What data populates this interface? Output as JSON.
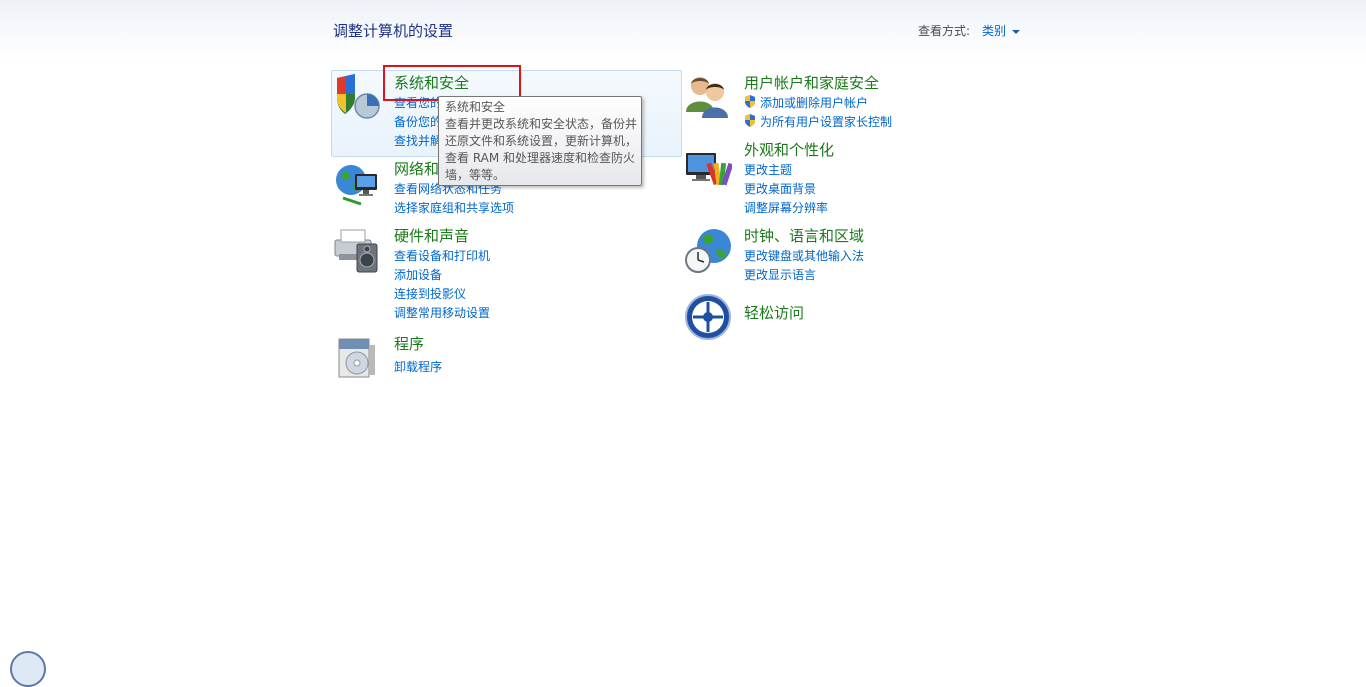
{
  "header": {
    "title": "调整计算机的设置",
    "view_by_label": "查看方式:",
    "view_by_value": "类别"
  },
  "categories": [
    {
      "title": "系统和安全",
      "icon": "shield-security-icon",
      "links": [
        "查看您的计算机状态",
        "备份您的计算机",
        "查找并解决问题"
      ]
    },
    {
      "title": "网络和 Internet",
      "icon": "network-globe-icon",
      "links": [
        "查看网络状态和任务",
        "选择家庭组和共享选项"
      ]
    },
    {
      "title": "硬件和声音",
      "icon": "printer-speaker-icon",
      "links": [
        "查看设备和打印机",
        "添加设备",
        "连接到投影仪",
        "调整常用移动设置"
      ]
    },
    {
      "title": "程序",
      "icon": "programs-box-icon",
      "links": [
        "卸载程序"
      ]
    },
    {
      "title": "用户帐户和家庭安全",
      "icon": "users-icon",
      "links": [
        "添加或删除用户帐户",
        "为所有用户设置家长控制"
      ]
    },
    {
      "title": "外观和个性化",
      "icon": "monitor-palette-icon",
      "links": [
        "更改主题",
        "更改桌面背景",
        "调整屏幕分辨率"
      ]
    },
    {
      "title": "时钟、语言和区域",
      "icon": "clock-globe-icon",
      "links": [
        "更改键盘或其他输入法",
        "更改显示语言"
      ]
    },
    {
      "title": "轻松访问",
      "icon": "ease-of-access-icon",
      "links": []
    }
  ],
  "tooltip": {
    "title": "系统和安全",
    "lines": [
      "查看并更改系统和安全状态，备份并",
      "还原文件和系统设置，更新计算机，",
      "查看 RAM 和处理器速度和检查防火",
      "墙，等等。"
    ]
  },
  "colors": {
    "title_blue": "#1e3287",
    "category_green": "#1a7a1a",
    "link_blue": "#0066cc",
    "highlight_red": "#e0111b"
  }
}
